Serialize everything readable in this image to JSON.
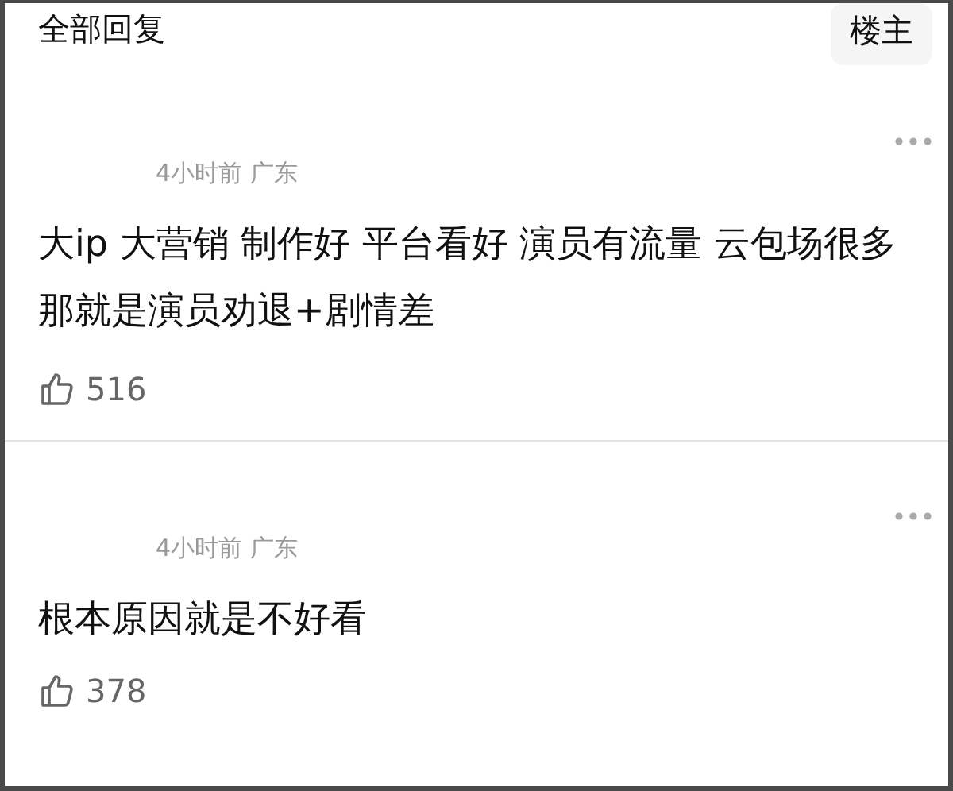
{
  "header": {
    "title": "全部回复",
    "filter_button": "楼主"
  },
  "comments": [
    {
      "meta": "4小时前 广东",
      "lines": [
        "大ip 大营销 制作好 平台看好 演员有流量 云包场很多",
        "那就是演员劝退+剧情差"
      ],
      "likes": "516"
    },
    {
      "meta": "4小时前 广东",
      "lines": [
        "根本原因就是不好看"
      ],
      "likes": "378"
    }
  ]
}
